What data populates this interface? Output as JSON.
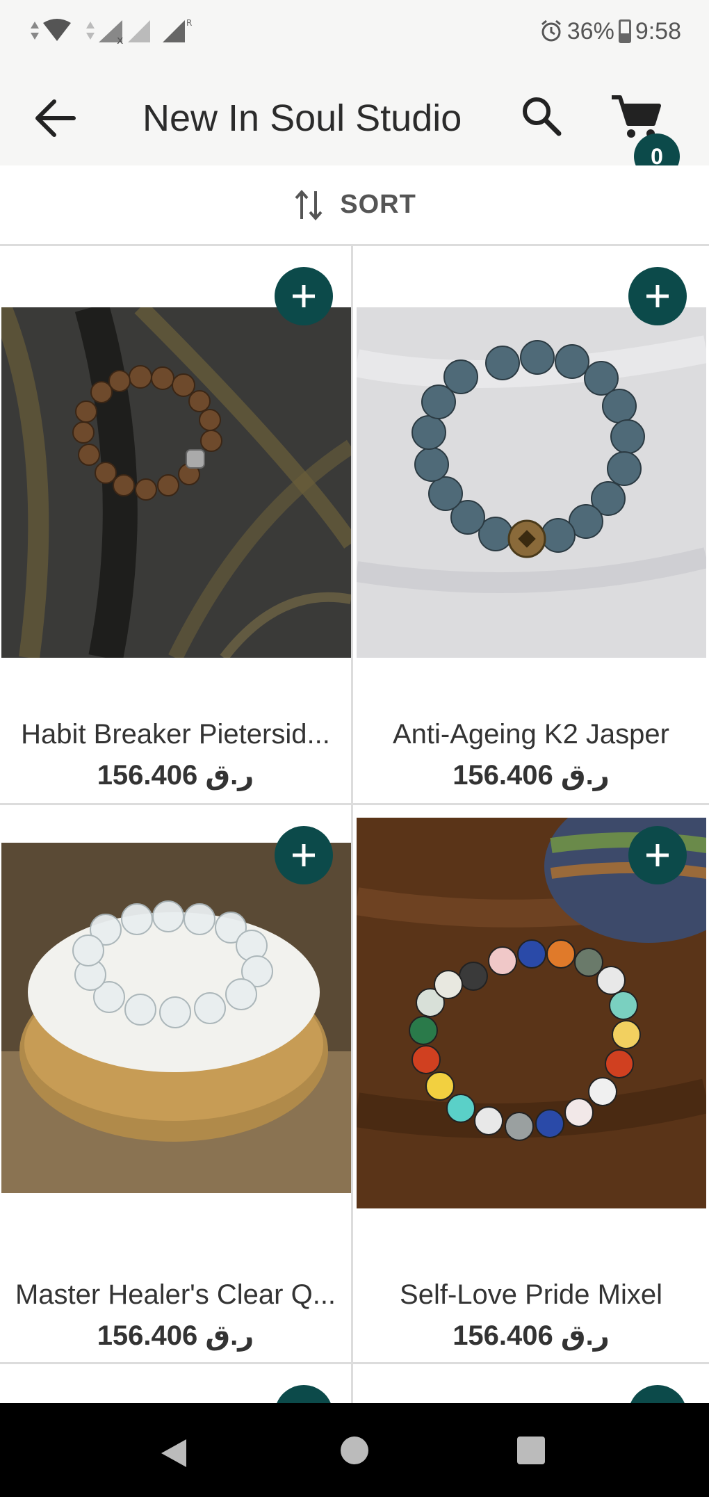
{
  "status": {
    "battery": "36%",
    "time": "9:58"
  },
  "header": {
    "title": "New In Soul Studio",
    "cart_count": "0"
  },
  "sort": {
    "label": "SORT"
  },
  "products": [
    {
      "name": "Habit Breaker Pietersid...",
      "price": "ر.ق 156.406"
    },
    {
      "name": "Anti-Ageing K2 Jasper",
      "price": "ر.ق 156.406"
    },
    {
      "name": "Master Healer's Clear Q...",
      "price": "ر.ق 156.406"
    },
    {
      "name": "Self-Love Pride Mixel",
      "price": "ر.ق 156.406"
    }
  ],
  "colors": {
    "accent": "#0c4a4a",
    "bar_background": "#f6f6f5",
    "divider": "#dcdcdc"
  }
}
